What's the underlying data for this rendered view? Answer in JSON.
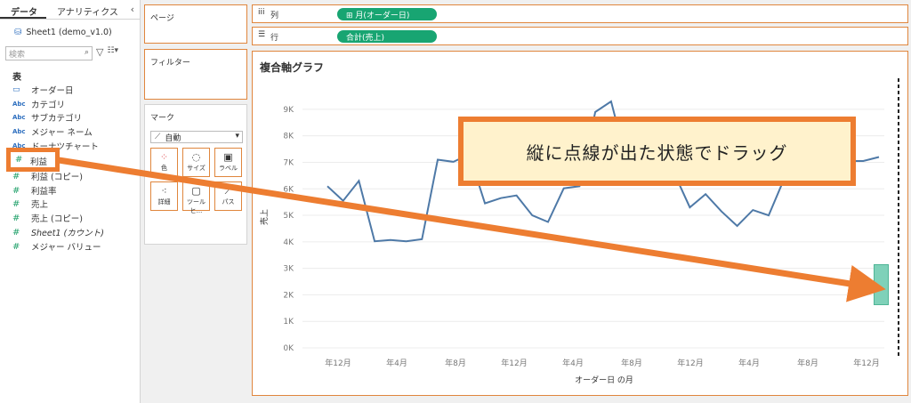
{
  "data_pane": {
    "tabs": [
      "データ",
      "アナリティクス"
    ],
    "collapse": "‹",
    "datasource": "Sheet1 (demo_v1.0)",
    "search_placeholder": "検索",
    "section": "表",
    "fields": [
      {
        "type": "cal",
        "label": "オーダー日"
      },
      {
        "type": "abc",
        "label": "カテゴリ"
      },
      {
        "type": "abc",
        "label": "サブカテゴリ"
      },
      {
        "type": "abc",
        "label": "メジャー ネーム"
      },
      {
        "type": "abc",
        "label": "ドーナツチャート"
      },
      {
        "type": "hash",
        "label": "利益"
      },
      {
        "type": "hash",
        "label": "利益 (コピー)"
      },
      {
        "type": "hash",
        "label": "利益率"
      },
      {
        "type": "hash",
        "label": "売上"
      },
      {
        "type": "hash",
        "label": "売上 (コピー)"
      },
      {
        "type": "hash",
        "label": "Sheet1 (カウント)"
      },
      {
        "type": "hash",
        "label": "メジャー バリュー"
      }
    ]
  },
  "shelves": {
    "pages": "ページ",
    "filters": "フィルター",
    "marks": "マーク",
    "marks_type": "自動",
    "mark_buttons": [
      "色",
      "サイズ",
      "ラベル",
      "詳細",
      "ツールヒ...",
      "パス"
    ],
    "columns_label": "列",
    "rows_label": "行",
    "columns_pill": "⊞ 月(オーダー日)",
    "rows_pill": "合計(売上)"
  },
  "chart_data": {
    "type": "line",
    "title": "複合軸グラフ",
    "xlabel": "オーダー日 の月",
    "ylabel": "売上",
    "y_ticks": [
      "9K",
      "8K",
      "7K",
      "6K",
      "5K",
      "4K",
      "3K",
      "2K",
      "1K",
      "0K"
    ],
    "x_ticks": [
      "年12月",
      "年4月",
      "年8月",
      "年12月",
      "年4月",
      "年8月",
      "年12月",
      "年4月",
      "年8月",
      "年12月"
    ],
    "ylim": [
      0,
      9500
    ],
    "color": "#4e79a7",
    "series": [
      {
        "values": [
          6100,
          5550,
          6300,
          4020,
          4070,
          4020,
          4100,
          7100,
          7020,
          7300,
          5450,
          5650,
          5750,
          5000,
          4750,
          6020,
          6100,
          8900,
          9300,
          7000,
          6800,
          7000,
          6600,
          5300,
          5800,
          5150,
          4600,
          5200,
          5000,
          6400,
          6800,
          7000,
          7200,
          7050,
          7050,
          7200
        ]
      }
    ]
  },
  "annotation": "縦に点線が出た状態でドラッグ",
  "dragged_pill": "利益",
  "colors": {
    "accent": "#ed7d31",
    "pill": "#18a572",
    "drop_zone": "#7fd1b9",
    "line": "#4e79a7"
  }
}
